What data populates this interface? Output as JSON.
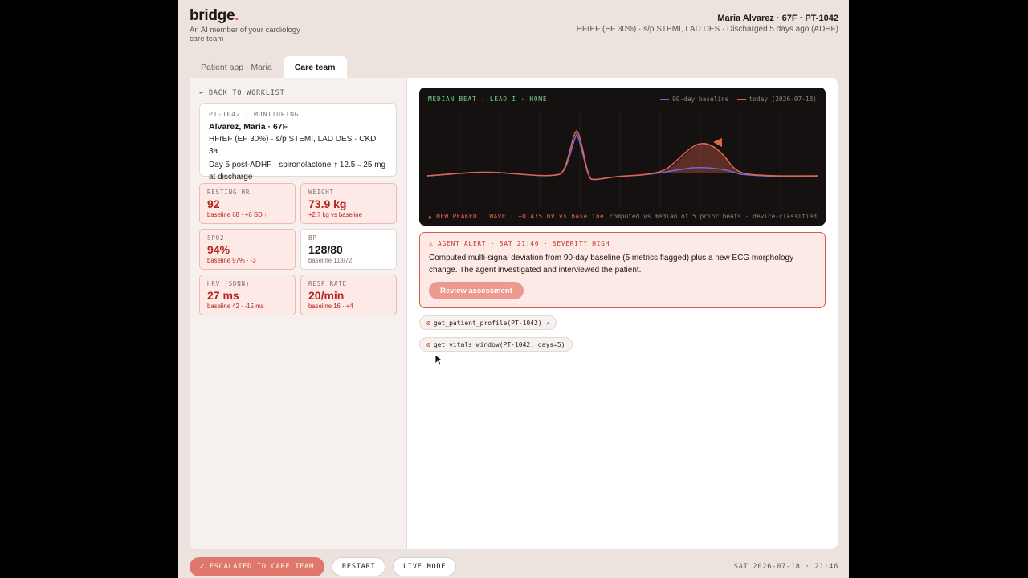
{
  "brand": {
    "logo": "bridge",
    "tagline": "An AI member of your cardiology care team",
    "accent": "#d9534f"
  },
  "patient_header": {
    "name": "Maria Alvarez · 67F · PT-1042",
    "summary": "HFrEF (EF 30%) · s/p STEMI, LAD DES · Discharged 5 days ago (ADHF)"
  },
  "tabs": [
    {
      "label": "Patient app · Maria",
      "active": false
    },
    {
      "label": "Care team",
      "active": true
    }
  ],
  "left": {
    "back_label": "← BACK TO WORKLIST",
    "card": {
      "id_line": "PT-1042 · MONITORING",
      "name": "Alvarez, Maria · 67F",
      "diagnosis": "HFrEF (EF 30%) · s/p STEMI, LAD DES · CKD 3a",
      "course": "Day 5 post-ADHF · spironolactone ↑ 12.5→25 mg at discharge"
    },
    "metrics": [
      {
        "label": "RESTING HR",
        "value": "92",
        "baseline": "baseline 68 · +6 SD ↑",
        "flagged": true
      },
      {
        "label": "WEIGHT",
        "value": "73.9 kg",
        "baseline": "+2.7 kg vs baseline",
        "flagged": true
      },
      {
        "label": "SPO2",
        "value": "94%",
        "baseline": "baseline 97% · -3",
        "flagged": true
      },
      {
        "label": "BP",
        "value": "128/80",
        "baseline": "baseline 118/72",
        "flagged": false
      },
      {
        "label": "HRV (SDNN)",
        "value": "27 ms",
        "baseline": "baseline 42 · -15 ms",
        "flagged": true
      },
      {
        "label": "RESP RATE",
        "value": "20/min",
        "baseline": "baseline 16 · +4",
        "flagged": true
      }
    ]
  },
  "ecg": {
    "title": "MEDIAN BEAT · LEAD I · HOME",
    "legend_baseline": "90-day baseline",
    "legend_today": "today (2026-07-18)",
    "baseline_color": "#6f6cd8",
    "today_color": "#e4654f",
    "footer_flag": "▲ NEW PEAKED T WAVE · +0.475 mV vs baseline",
    "footer_note": "computed vs median of 5 prior beats · device-classified"
  },
  "alert": {
    "header": "⚠ AGENT ALERT · SAT 21:40 · SEVERITY HIGH",
    "text": "Computed multi-signal deviation from 90-day baseline (5 metrics flagged) plus a new ECG morphology change. The agent investigated and interviewed the patient.",
    "button": "Review assessment"
  },
  "tool_calls": [
    {
      "icon": "⚙",
      "text": "get_patient_profile(PT-1042) ✓"
    },
    {
      "icon": "⚙",
      "text": "get_vitals_window(PT-1042, days=5)"
    }
  ],
  "bottom": {
    "escalated": "✓ ESCALATED TO CARE TEAM",
    "restart": "RESTART",
    "live": "LIVE MODE",
    "timestamp": "SAT 2026-07-18 · 21:46"
  }
}
